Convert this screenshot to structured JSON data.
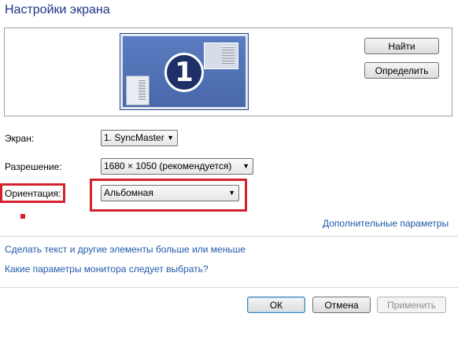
{
  "window": {
    "title": "Настройки экрана"
  },
  "preview": {
    "monitor_number": "1"
  },
  "buttons": {
    "find": "Найти",
    "identify": "Определить"
  },
  "fields": {
    "screen": {
      "label": "Экран:",
      "value": "1. SyncMaster"
    },
    "resolution": {
      "label": "Разрешение:",
      "value": "1680 × 1050 (рекомендуется)"
    },
    "orientation": {
      "label": "Ориентация:",
      "value": "Альбомная"
    }
  },
  "links": {
    "advanced": "Дополнительные параметры",
    "text_size": "Сделать текст и другие элементы больше или меньше",
    "which_settings": "Какие параметры монитора следует выбрать?"
  },
  "footer": {
    "ok": "ОК",
    "cancel": "Отмена",
    "apply": "Применить"
  },
  "colors": {
    "title": "#1e3287",
    "link": "#1f5aa8",
    "highlight": "#d4222c"
  }
}
